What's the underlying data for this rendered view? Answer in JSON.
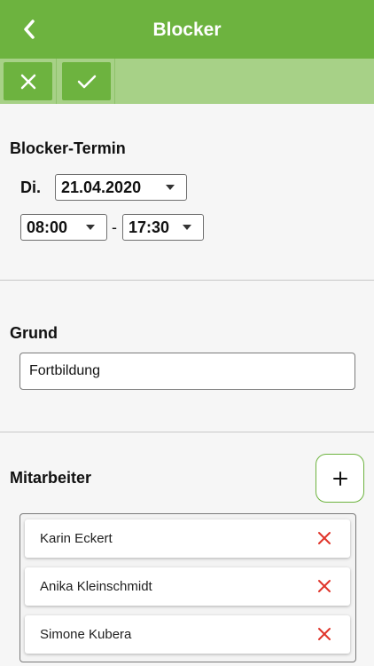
{
  "header": {
    "title": "Blocker",
    "back_icon": "chevron-left-icon"
  },
  "toolbar": {
    "cancel_icon": "close-icon",
    "confirm_icon": "checkmark-icon"
  },
  "appointment": {
    "section_title": "Blocker-Termin",
    "weekday": "Di.",
    "date": "21.04.2020",
    "time_from": "08:00",
    "time_separator": "-",
    "time_to": "17:30"
  },
  "reason": {
    "section_title": "Grund",
    "value": "Fortbildung"
  },
  "employees": {
    "section_title": "Mitarbeiter",
    "add_icon": "plus-icon",
    "remove_icon": "close-icon",
    "items": [
      {
        "name": "Karin Eckert"
      },
      {
        "name": "Anika Kleinschmidt"
      },
      {
        "name": "Simone Kubera"
      }
    ]
  },
  "colors": {
    "brand_green": "#6db33f",
    "toolbar_green": "#a7d187",
    "remove_red": "#e0352b"
  }
}
